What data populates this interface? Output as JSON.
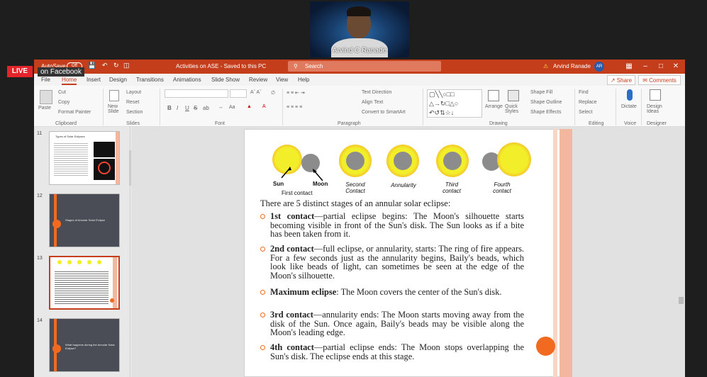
{
  "webcam": {
    "name": "Arvind C Ranade"
  },
  "live": {
    "badge": "LIVE",
    "platform": "on Facebook"
  },
  "titlebar": {
    "autosave": "AutoSave",
    "autosave_state": "Off",
    "doc_title": "Activities on ASE  -  Saved to this PC",
    "search_placeholder": "Search",
    "user_name": "Arvind Ranade",
    "user_initials": "AR"
  },
  "menu": {
    "tabs": [
      "File",
      "Home",
      "Insert",
      "Design",
      "Transitions",
      "Animations",
      "Slide Show",
      "Review",
      "View",
      "Help"
    ],
    "active": "Home",
    "share": "Share",
    "comments": "Comments"
  },
  "ribbon": {
    "clipboard": {
      "label": "Clipboard",
      "paste": "Paste",
      "cut": "Cut",
      "copy": "Copy",
      "format_painter": "Format Painter"
    },
    "slides": {
      "label": "Slides",
      "new_slide": "New Slide",
      "layout": "Layout",
      "reset": "Reset",
      "section": "Section"
    },
    "font": {
      "label": "Font",
      "bold": "B",
      "italic": "I",
      "underline": "U",
      "strike": "S",
      "shadow": "ab"
    },
    "paragraph": {
      "label": "Paragraph",
      "text_direction": "Text Direction",
      "align_text": "Align Text",
      "smartart": "Convert to SmartArt"
    },
    "drawing": {
      "label": "Drawing",
      "arrange": "Arrange",
      "quick_styles": "Quick Styles",
      "shape_fill": "Shape Fill",
      "shape_outline": "Shape Outline",
      "shape_effects": "Shape Effects"
    },
    "editing": {
      "label": "Editing",
      "find": "Find",
      "replace": "Replace",
      "select": "Select"
    },
    "voice": {
      "label": "Voice",
      "dictate": "Dictate"
    },
    "designer": {
      "label": "Designer",
      "design_ideas": "Design Ideas"
    }
  },
  "thumbnails": [
    {
      "num": "11",
      "title": "Types of Solar Eclipses"
    },
    {
      "num": "12",
      "title": "Stages of Annular Solar Eclipse"
    },
    {
      "num": "13",
      "title": ""
    },
    {
      "num": "14",
      "title": "What happens during the Annular Solar Eclipse?"
    }
  ],
  "slide": {
    "stages": [
      {
        "caption_top": "Sun",
        "caption_top2": "Moon",
        "caption": "First contact"
      },
      {
        "caption": "Second Contact"
      },
      {
        "caption": "Annularity"
      },
      {
        "caption": "Third contact"
      },
      {
        "caption": "Fourth contact"
      }
    ],
    "intro": "There are 5 distinct stages of an annular solar eclipse:",
    "bullets": [
      {
        "head": "1st contact",
        "text": "—partial eclipse begins: The Moon's silhouette starts becoming visible in front of the Sun's disk. The Sun looks as if a bite has been taken from it."
      },
      {
        "head": "2nd contact",
        "text": "—full eclipse, or annularity, starts: The ring of fire appears. For a few seconds just as the annularity begins, Baily's beads, which look like beads of light, can sometimes be seen at the edge of the Moon's silhouette."
      },
      {
        "head": "Maximum eclipse",
        "text": ": The Moon covers the center of the Sun's disk."
      },
      {
        "head": "3rd contact",
        "text": "—annularity ends: The Moon starts moving away from the disk of the Sun. Once again, Baily's beads may be visible along the Moon's leading edge."
      },
      {
        "head": "4th contact",
        "text": "—partial eclipse ends: The Moon stops overlapping the Sun's disk. The eclipse ends at this stage."
      }
    ]
  },
  "colors": {
    "ppt_red": "#c43e1c",
    "accent_orange": "#f26a1f",
    "live_red": "#e4232a"
  }
}
